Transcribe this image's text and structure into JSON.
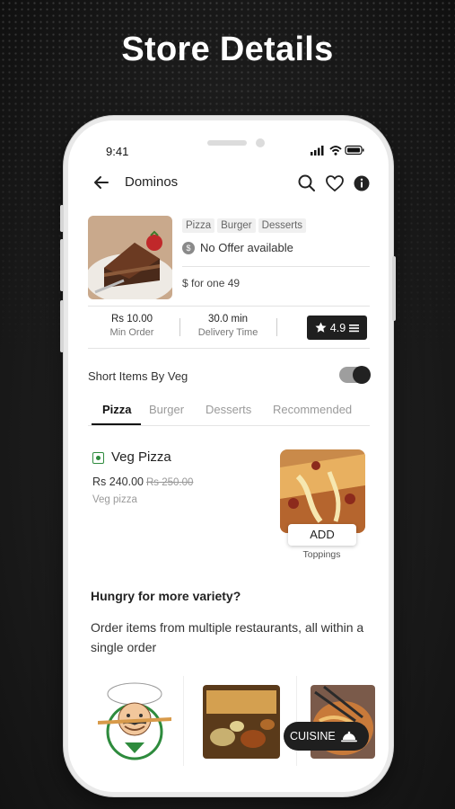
{
  "headline": "Store Details",
  "status_bar": {
    "time": "9:41"
  },
  "header": {
    "title": "Dominos",
    "back_icon": "arrow-left-icon",
    "icons": [
      "search-icon",
      "heart-icon",
      "info-icon"
    ]
  },
  "store": {
    "tags": [
      "Pizza",
      "Burger",
      "Desserts"
    ],
    "offer": "No Offer available",
    "price_for_one": "$ for one 49",
    "stats": [
      {
        "value": "Rs 10.00",
        "label": "Min Order"
      },
      {
        "value": "30.0 min",
        "label": "Delivery Time"
      }
    ],
    "rating": "4.9"
  },
  "filter": {
    "label": "Short Items By Veg",
    "toggle_on": true
  },
  "tabs": [
    {
      "label": "Pizza",
      "active": true
    },
    {
      "label": "Burger",
      "active": false
    },
    {
      "label": "Desserts",
      "active": false
    },
    {
      "label": "Recommended",
      "active": false
    }
  ],
  "item": {
    "name": "Veg Pizza",
    "price": "Rs 240.00",
    "old_price": "Rs 250.00",
    "description": "Veg pizza",
    "add_label": "ADD",
    "toppings_label": "Toppings"
  },
  "promo": {
    "heading": "Hungry for more variety?",
    "text": "Order items from multiple restaurants, all within a single order"
  },
  "cuisine_button": {
    "label": "CUISINE",
    "icon": "cloche-icon"
  },
  "colors": {
    "veg_green": "#2e8b3d",
    "dark": "#1f1f1f"
  }
}
